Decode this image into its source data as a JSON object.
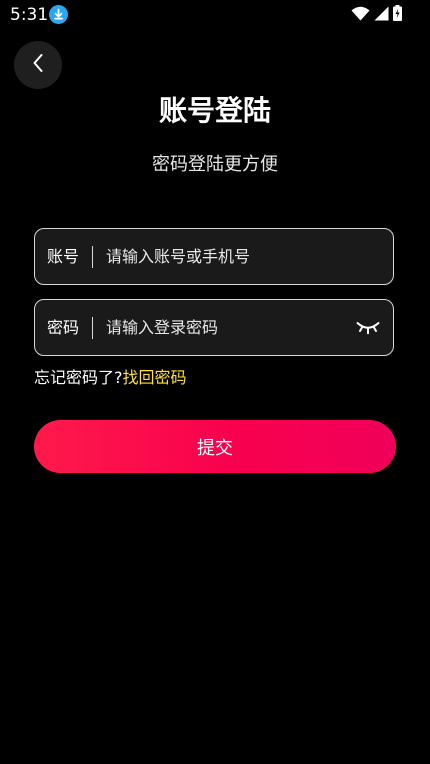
{
  "status_bar": {
    "time": "5:31",
    "download_badge_color": "#2aa7f3",
    "icons": [
      "download-icon",
      "wifi-icon",
      "signal-icon",
      "battery-icon"
    ]
  },
  "header": {
    "back_icon": "chevron-left-icon",
    "title": "账号登陆",
    "subtitle": "密码登陆更方便"
  },
  "form": {
    "account": {
      "label": "账号",
      "placeholder": "请输入账号或手机号",
      "value": ""
    },
    "password": {
      "label": "密码",
      "placeholder": "请输入登录密码",
      "value": "",
      "toggle_icon": "eye-closed-icon"
    },
    "forgot": {
      "text": "忘记密码了?",
      "link": "找回密码",
      "link_color": "#ffe03a"
    },
    "submit_label": "提交",
    "accent_color": "#f8004e"
  }
}
